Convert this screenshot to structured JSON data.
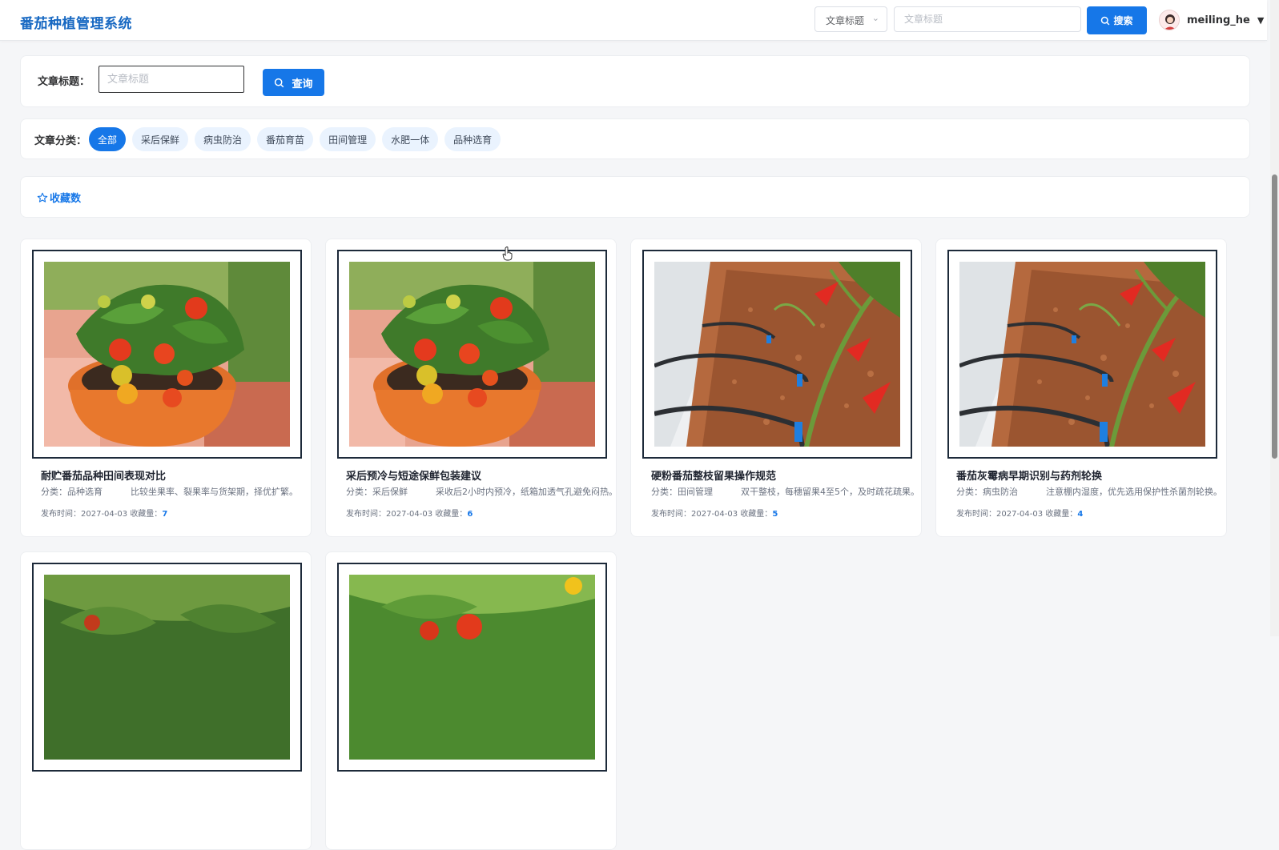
{
  "app": {
    "title": "番茄种植管理系统"
  },
  "header": {
    "search_field_select": "文章标题",
    "search_placeholder": "文章标题",
    "search_button": "搜索",
    "username": "meiling_he"
  },
  "query": {
    "label": "文章标题：",
    "placeholder": "文章标题",
    "button": "查询"
  },
  "categories": {
    "label": "文章分类：",
    "items": [
      "全部",
      "采后保鲜",
      "病虫防治",
      "番茄育苗",
      "田间管理",
      "水肥一体",
      "品种选育"
    ],
    "active": "全部"
  },
  "sort": {
    "label": "收藏数"
  },
  "cards": [
    {
      "title": "耐贮番茄品种田间表现对比",
      "category_label": "分类：品种选育",
      "summary": "比较坐果率、裂果率与货架期，择优扩繁。",
      "date_label": "发布时间：2027-04-03",
      "fav_label": "收藏量：",
      "fav_count": "7",
      "image": "potted-tomato"
    },
    {
      "title": "采后预冷与短途保鲜包装建议",
      "category_label": "分类：采后保鲜",
      "summary": "采收后2小时内预冷，纸箱加透气孔避免闷热。",
      "date_label": "发布时间：2027-04-03",
      "fav_label": "收藏量：",
      "fav_count": "6",
      "image": "potted-tomato"
    },
    {
      "title": "硬粉番茄整枝留果操作规范",
      "category_label": "分类：田间管理",
      "summary": "双干整枝，每穗留果4至5个，及时疏花疏果。",
      "date_label": "发布时间：2027-04-03",
      "fav_label": "收藏量：",
      "fav_count": "5",
      "image": "drip-irrigation"
    },
    {
      "title": "番茄灰霉病早期识别与药剂轮换",
      "category_label": "分类：病虫防治",
      "summary": "注意棚内湿度，优先选用保护性杀菌剂轮换。",
      "date_label": "发布时间：2027-04-03",
      "fav_label": "收藏量：",
      "fav_count": "4",
      "image": "drip-irrigation"
    },
    {
      "image": "tomato-plant"
    },
    {
      "image": "tomato-field"
    }
  ],
  "colors": {
    "brand": "#1768c2",
    "primary": "#1677e8",
    "chip_bg": "#eaf3fe"
  }
}
